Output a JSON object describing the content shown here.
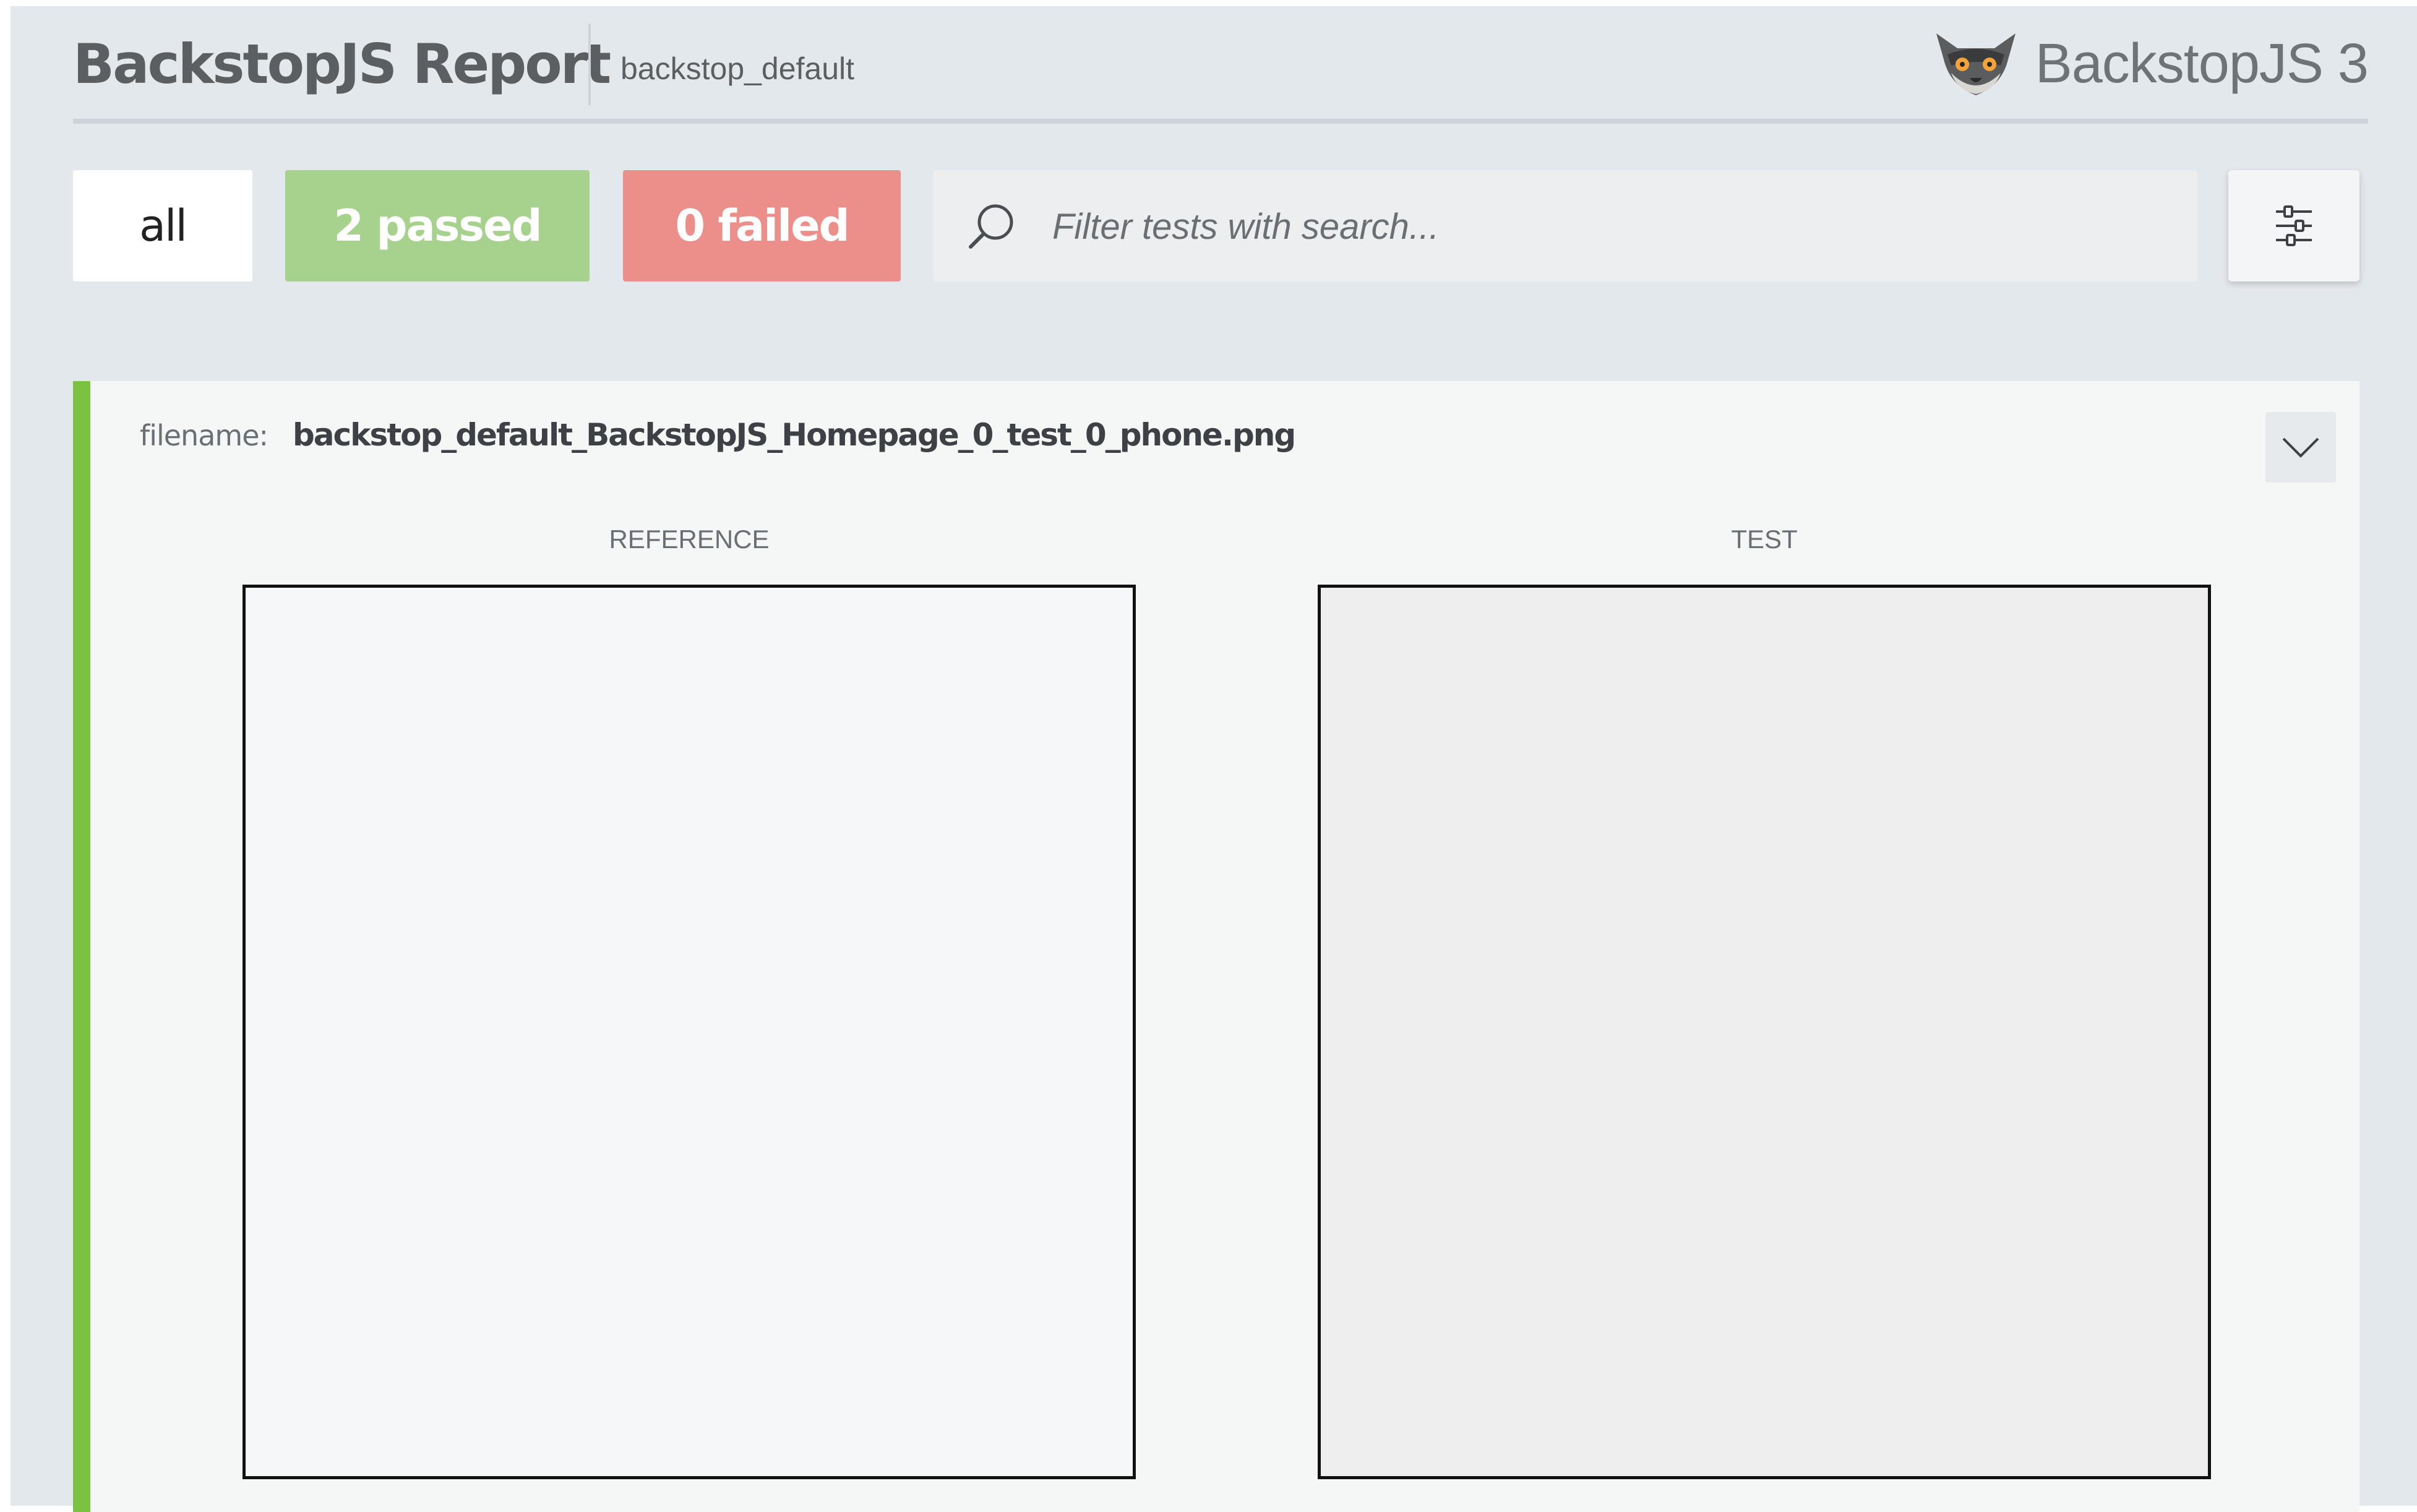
{
  "header": {
    "title": "BackstopJS Report",
    "project": "backstop_default",
    "brand": "BackstopJS 3",
    "brand_icon": "lemur-logo-icon"
  },
  "toolbar": {
    "all_label": "all",
    "passed_label": "2 passed",
    "failed_label": "0 failed",
    "search_placeholder": "Filter tests with search...",
    "search_icon": "search-icon",
    "settings_icon": "settings-sliders-icon"
  },
  "colors": {
    "background": "#e3e8ec",
    "passed": "#a6d28e",
    "failed": "#ec8e8a",
    "card_status": "#7cc242"
  },
  "test_card": {
    "status": "passed",
    "filename_label": "filename:",
    "filename": "backstop_default_BackstopJS_Homepage_0_test_0_phone.png",
    "reference_label": "REFERENCE",
    "test_label": "TEST",
    "collapse_icon": "chevron-down-icon"
  }
}
